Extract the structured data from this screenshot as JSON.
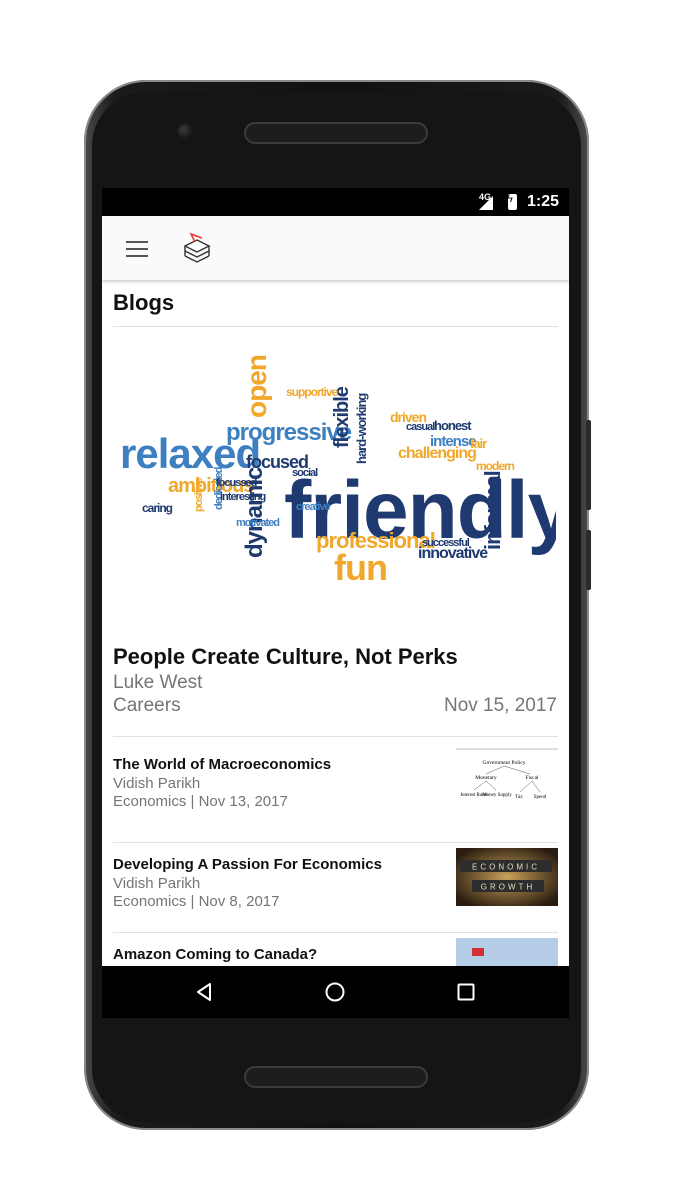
{
  "status_bar": {
    "network": "4G",
    "time": "1:25"
  },
  "app_bar": {
    "menu_icon": "hamburger-menu-icon",
    "logo_icon": "stacked-books-logo-icon"
  },
  "blogs": {
    "section_title": "Blogs",
    "featured": {
      "image_words": [
        "relaxed",
        "ambitious",
        "caring",
        "progressive",
        "open",
        "focused",
        "flexible",
        "dynamic",
        "friendly",
        "fun",
        "professional",
        "innovative",
        "challenging",
        "driven",
        "hard-working",
        "dedicated",
        "supportive",
        "motivated",
        "interesting",
        "focussed",
        "casual",
        "social",
        "honest",
        "intense",
        "fair",
        "modern",
        "informal",
        "creative",
        "positive",
        "successful"
      ],
      "title": "People Create Culture, Not Perks",
      "author": "Luke West",
      "category": "Careers",
      "date": "Nov 15, 2017"
    },
    "posts": [
      {
        "title": "The World of Macroeconomics",
        "author": "Vidish Parikh",
        "meta": "Economics | Nov 13, 2017",
        "thumb_labels": [
          "Government Policy",
          "Monetary",
          "Fiscal",
          "Interest Rates",
          "Money Supply",
          "Tax",
          "Spend"
        ]
      },
      {
        "title": "Developing A Passion For Economics",
        "author": "Vidish Parikh",
        "meta": "Economics | Nov 8, 2017",
        "thumb_labels": [
          "ECONOMIC",
          "GROWTH"
        ]
      },
      {
        "title": "Amazon Coming to Canada?",
        "author": "",
        "meta": "",
        "thumb_labels": []
      }
    ]
  },
  "nav_bar": {
    "back_icon": "back-triangle-icon",
    "home_icon": "home-circle-icon",
    "recents_icon": "recents-square-icon"
  },
  "colors": {
    "word_navy": "#1f3a70",
    "word_blue": "#3d7fc1",
    "word_orange": "#f0a72a",
    "text_gray": "#757575"
  }
}
